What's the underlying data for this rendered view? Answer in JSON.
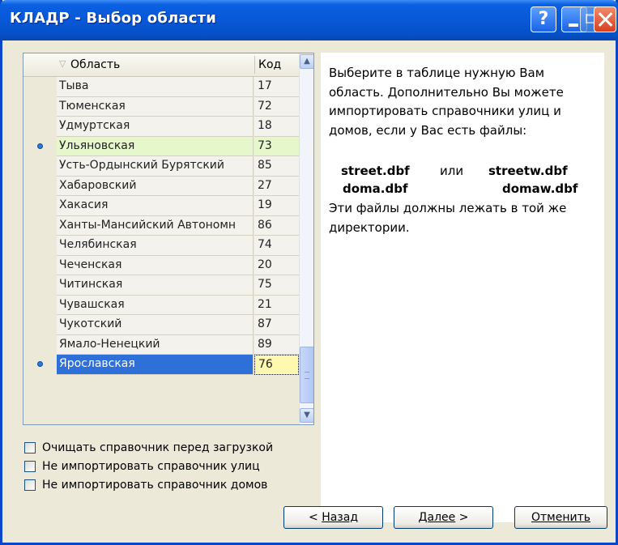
{
  "window": {
    "title": "КЛАДР - Выбор области",
    "help_label": "?"
  },
  "grid": {
    "columns": {
      "name": "Область",
      "code": "Код"
    },
    "rows": [
      {
        "name": "Тыва",
        "code": "17"
      },
      {
        "name": "Тюменская",
        "code": "72"
      },
      {
        "name": "Удмуртская",
        "code": "18"
      },
      {
        "name": "Ульяновская",
        "code": "73"
      },
      {
        "name": "Усть-Ордынский Бурятский",
        "code": "85"
      },
      {
        "name": "Хабаровский",
        "code": "27"
      },
      {
        "name": "Хакасия",
        "code": "19"
      },
      {
        "name": "Ханты-Мансийский Автономн",
        "code": "86"
      },
      {
        "name": "Челябинская",
        "code": "74"
      },
      {
        "name": "Чеченская",
        "code": "20"
      },
      {
        "name": "Читинская",
        "code": "75"
      },
      {
        "name": "Чувашская",
        "code": "21"
      },
      {
        "name": "Чукотский",
        "code": "87"
      },
      {
        "name": "Ямало-Ненецкий",
        "code": "89"
      },
      {
        "name": "Ярославская",
        "code": "76"
      }
    ],
    "highlight_color": "#e6f7cc",
    "selection_color": "#2e6fd8"
  },
  "info": {
    "text": "Выберите в таблице нужную Вам область. Дополнительно Вы можете импортировать справочники улиц и домов, если у Вас есть файлы:",
    "file1": "street.dbf",
    "or": "или",
    "file2": "streetw.dbf",
    "file3": "doma.dbf",
    "file4": "domaw.dbf",
    "text2": "Эти файлы должны лежать в той же директории."
  },
  "options": [
    {
      "label": "Очищать справочник перед загрузкой",
      "checked": false
    },
    {
      "label": "Не импортировать справочник улиц",
      "checked": false
    },
    {
      "label": "Не импортировать справочник домов",
      "checked": false
    }
  ],
  "buttons": {
    "back_prefix": "< ",
    "back_label": "Назад",
    "next_label": "Далее",
    "next_suffix": " >",
    "cancel_label": "Отменить"
  },
  "icons": {
    "sort": "sort-icon",
    "scroll_up": "scroll-up-arrow-icon",
    "scroll_down": "scroll-down-arrow-icon"
  }
}
